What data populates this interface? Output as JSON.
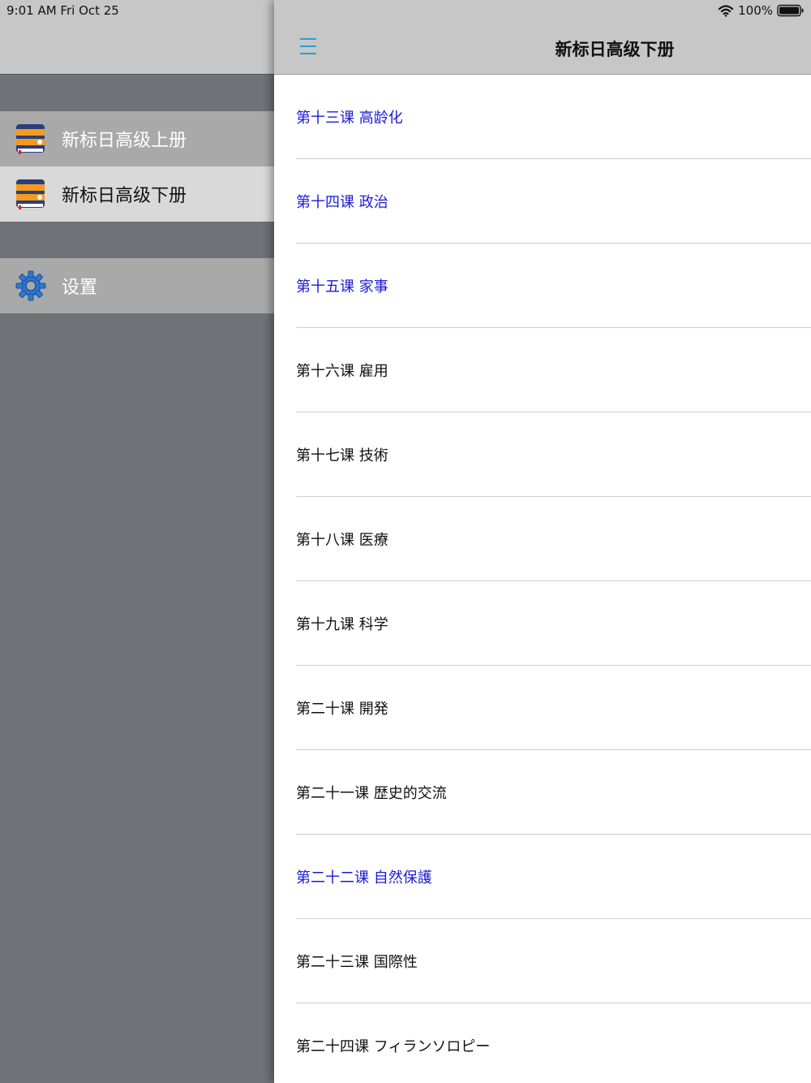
{
  "status_bar": {
    "time_date": "9:01 AM   Fri Oct 25",
    "battery_percent": "100%",
    "battery_level": 1.0,
    "icons": [
      "wifi-icon",
      "battery-icon"
    ]
  },
  "sidebar": {
    "items": [
      {
        "label": "新标日高级上册",
        "icon": "book-icon",
        "selected": false
      },
      {
        "label": "新标日高级下册",
        "icon": "book-icon",
        "selected": true
      },
      {
        "label": "设置",
        "icon": "gear-icon",
        "selected": false
      }
    ]
  },
  "navbar": {
    "title": "新标日高级下册",
    "menu_icon": "hamburger-icon"
  },
  "colors": {
    "accent": "#1b1bd6",
    "menu_icon": "#2e9bd6",
    "text_default": "#111111",
    "sidebar_bg": "#6f7377"
  },
  "lessons": [
    {
      "label": "第十三课 高龄化",
      "highlighted": true
    },
    {
      "label": "第十四课 政治",
      "highlighted": true
    },
    {
      "label": "第十五课 家事",
      "highlighted": true
    },
    {
      "label": "第十六课 雇用",
      "highlighted": false
    },
    {
      "label": "第十七课 技術",
      "highlighted": false
    },
    {
      "label": "第十八课 医療",
      "highlighted": false
    },
    {
      "label": "第十九课 科学",
      "highlighted": false
    },
    {
      "label": "第二十课 開発",
      "highlighted": false
    },
    {
      "label": "第二十一课 歴史的交流",
      "highlighted": false
    },
    {
      "label": "第二十二课 自然保護",
      "highlighted": true
    },
    {
      "label": "第二十三课 国際性",
      "highlighted": false
    },
    {
      "label": "第二十四课 フィランソロピー",
      "highlighted": false
    }
  ]
}
